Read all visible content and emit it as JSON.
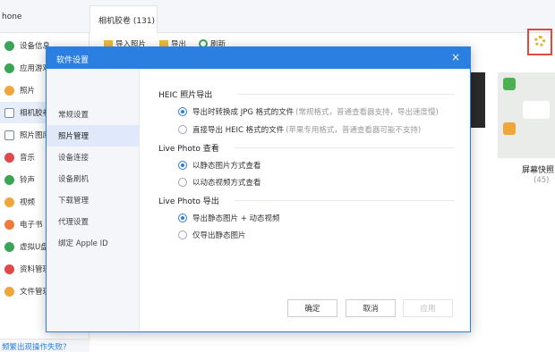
{
  "app": {
    "device_name": "hone",
    "tab_label": "相机胶卷 (131)",
    "toolbar": {
      "import_label": "导入照片",
      "export_label": "导出",
      "refresh_label": "刷新"
    },
    "sidebar": {
      "items": [
        {
          "label": "设备信息"
        },
        {
          "label": "应用游戏"
        },
        {
          "label": "照片"
        },
        {
          "label": "相机胶卷"
        },
        {
          "label": "照片图库"
        },
        {
          "label": "音乐"
        },
        {
          "label": "铃声"
        },
        {
          "label": "视频"
        },
        {
          "label": "电子书"
        },
        {
          "label": "虚拟U盘"
        },
        {
          "label": "资料管理"
        },
        {
          "label": "文件管理"
        }
      ],
      "footer_link": "频繁出现操作失败?"
    },
    "album": {
      "name": "屏幕快照",
      "count": "(45)"
    }
  },
  "dialog": {
    "title": "软件设置",
    "close_glyph": "×",
    "nav": [
      {
        "label": "常规设置"
      },
      {
        "label": "照片管理"
      },
      {
        "label": "设备连接"
      },
      {
        "label": "设备刷机"
      },
      {
        "label": "下载管理"
      },
      {
        "label": "代理设置"
      },
      {
        "label": "绑定 Apple ID"
      }
    ],
    "sections": {
      "heic": {
        "title": "HEIC 照片导出",
        "options": [
          {
            "label": "导出时转换成 JPG 格式的文件",
            "note": "(常规格式，普通查看器支持，导出速度慢)",
            "selected": true
          },
          {
            "label": "直接导出 HEIC 格式的文件",
            "note": "(苹果专用格式，普通查看器可能不支持)",
            "selected": false
          }
        ]
      },
      "live_view": {
        "title": "Live Photo 查看",
        "options": [
          {
            "label": "以静态图片方式查看",
            "selected": true
          },
          {
            "label": "以动态视频方式查看",
            "selected": false
          }
        ]
      },
      "live_export": {
        "title": "Live Photo 导出",
        "options": [
          {
            "label": "导出静态图片 + 动态视频",
            "selected": true
          },
          {
            "label": "仅导出静态图片",
            "selected": false
          }
        ]
      }
    },
    "buttons": {
      "ok": "确定",
      "cancel": "取消",
      "apply": "应用"
    }
  },
  "colors": {
    "accent": "#2a7fe0",
    "highlight_border": "#e04a3a"
  }
}
